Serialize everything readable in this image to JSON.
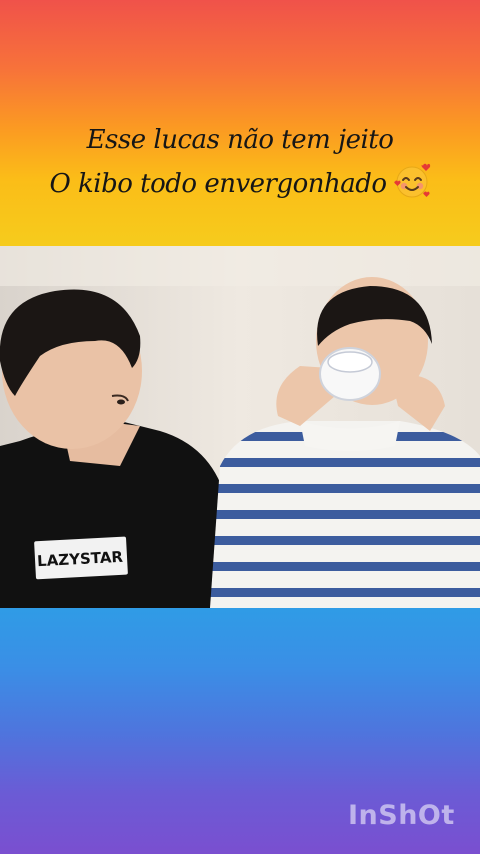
{
  "caption": {
    "line1": "Esse lucas não tem jeito",
    "line2": "O kibo  todo envergonhado",
    "emoji": "smiling-face-with-hearts-icon"
  },
  "video": {
    "shirt_print": "LAZYSTAR"
  },
  "watermark": {
    "label": "InShOt"
  },
  "colors": {
    "gradient_top": "#f0524a",
    "gradient_yellow": "#f6cb1c",
    "gradient_blue": "#2f9ce6",
    "gradient_bottom": "#7a4fd0",
    "stripe_blue": "#3c5c9e"
  }
}
